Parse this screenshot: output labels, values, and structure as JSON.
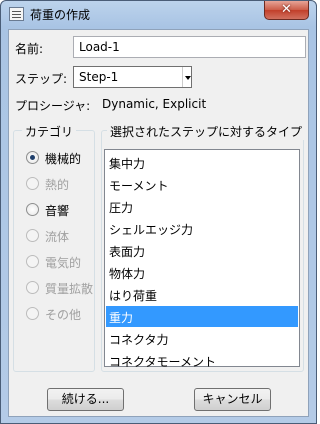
{
  "window": {
    "title": "荷重の作成",
    "close_glyph": "✕"
  },
  "form": {
    "name_label": "名前:",
    "name_value": "Load-1",
    "step_label": "ステップ:",
    "step_value": "Step-1",
    "procedure_label": "プロシージャ:",
    "procedure_value": "Dynamic, Explicit"
  },
  "category": {
    "title": "カテゴリ",
    "options": [
      {
        "label": "機械的",
        "checked": true,
        "enabled": true
      },
      {
        "label": "熱的",
        "checked": false,
        "enabled": false
      },
      {
        "label": "音響",
        "checked": false,
        "enabled": true
      },
      {
        "label": "流体",
        "checked": false,
        "enabled": false
      },
      {
        "label": "電気的",
        "checked": false,
        "enabled": false
      },
      {
        "label": "質量拡散",
        "checked": false,
        "enabled": false
      },
      {
        "label": "その他",
        "checked": false,
        "enabled": false
      }
    ]
  },
  "types": {
    "title": "選択されたステップに対するタイプ",
    "items": [
      "集中力",
      "モーメント",
      "圧力",
      "シェルエッジ力",
      "表面力",
      "物体力",
      "はり荷重",
      "重力",
      "コネクタ力",
      "コネクタモーメント"
    ],
    "selected": "重力"
  },
  "buttons": {
    "continue": "続ける...",
    "cancel": "キャンセル"
  }
}
